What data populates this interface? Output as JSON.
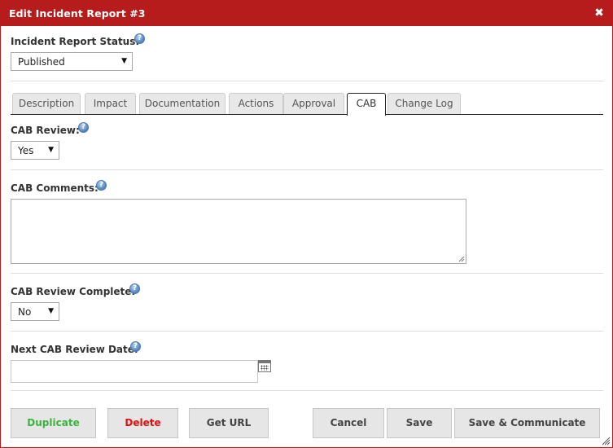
{
  "dialog": {
    "title": "Edit Incident Report #3",
    "close_icon": "close-icon"
  },
  "status": {
    "label": "Incident Report Status:",
    "value": "Published"
  },
  "tabs": [
    {
      "label": "Description",
      "active": false
    },
    {
      "label": "Impact",
      "active": false
    },
    {
      "label": "Documentation",
      "active": false
    },
    {
      "label": "Actions",
      "active": false
    },
    {
      "label": "Approval",
      "active": false
    },
    {
      "label": "CAB",
      "active": true
    },
    {
      "label": "Change Log",
      "active": false
    }
  ],
  "cab_review": {
    "label": "CAB Review:",
    "value": "Yes"
  },
  "cab_comments": {
    "label": "CAB Comments:",
    "value": ""
  },
  "cab_review_complete": {
    "label": "CAB Review Complete:",
    "value": "No"
  },
  "next_review_date": {
    "label": "Next CAB Review Date:",
    "value": ""
  },
  "help_icon": "?",
  "buttons": {
    "duplicate": "Duplicate",
    "delete": "Delete",
    "get_url": "Get URL",
    "cancel": "Cancel",
    "save": "Save",
    "save_communicate": "Save & Communicate"
  },
  "colors": {
    "titlebar": "#b71c1c",
    "duplicate_text": "#3cb43c",
    "delete_text": "#e01010"
  }
}
